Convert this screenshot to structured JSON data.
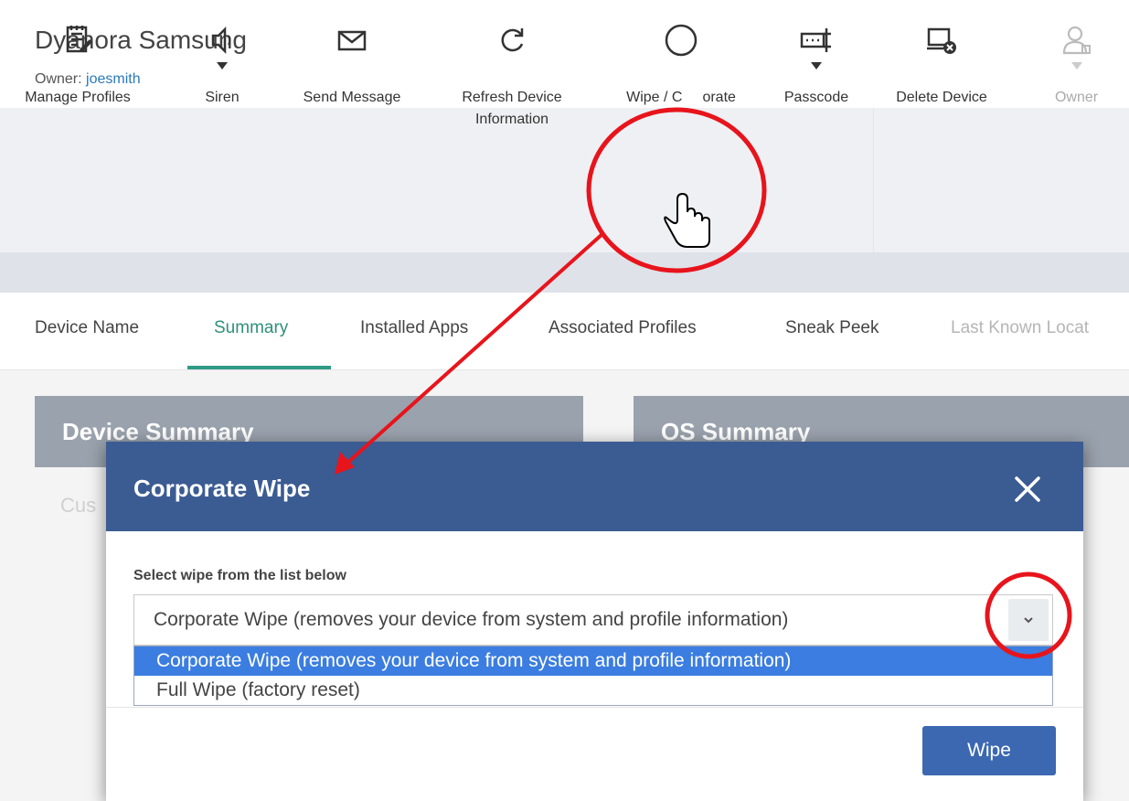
{
  "device": {
    "title": "Dyanora Samsung",
    "owner_label": "Owner:",
    "owner_name": "joesmith"
  },
  "toolbar": {
    "items": [
      {
        "label": "Manage Profiles",
        "icon": "manage-profiles-icon"
      },
      {
        "label": "Siren",
        "icon": "speaker-icon"
      },
      {
        "label": "Send Message",
        "icon": "envelope-icon"
      },
      {
        "label": "Refresh Device",
        "label2": "Information",
        "icon": "refresh-icon"
      },
      {
        "label": "Wipe / C",
        "label_tail": "orate",
        "icon": "circle-icon"
      },
      {
        "label": "Passcode",
        "icon": "passcode-icon"
      },
      {
        "label": "Delete Device",
        "icon": "delete-device-icon"
      },
      {
        "label": "Owner",
        "icon": "owner-icon"
      }
    ]
  },
  "tabs": [
    "Device Name",
    "Summary",
    "Installed Apps",
    "Associated Profiles",
    "Sneak Peek",
    "Last Known Locat"
  ],
  "active_tab": "Summary",
  "cards": {
    "device_summary": "Device Summary",
    "os_summary": "OS Summary",
    "ghost": "Cus"
  },
  "modal": {
    "title": "Corporate Wipe",
    "field_label": "Select wipe from the list below",
    "selected_value": "Corporate Wipe (removes your device from system and profile information)",
    "options": [
      "Corporate Wipe (removes your device from system and profile information)",
      "Full Wipe (factory reset)"
    ],
    "submit_label": "Wipe"
  },
  "colors": {
    "modal_header": "#3b5b93",
    "accent_tab": "#2f9b86",
    "annotation": "#e8141c",
    "button": "#3c68b2"
  }
}
